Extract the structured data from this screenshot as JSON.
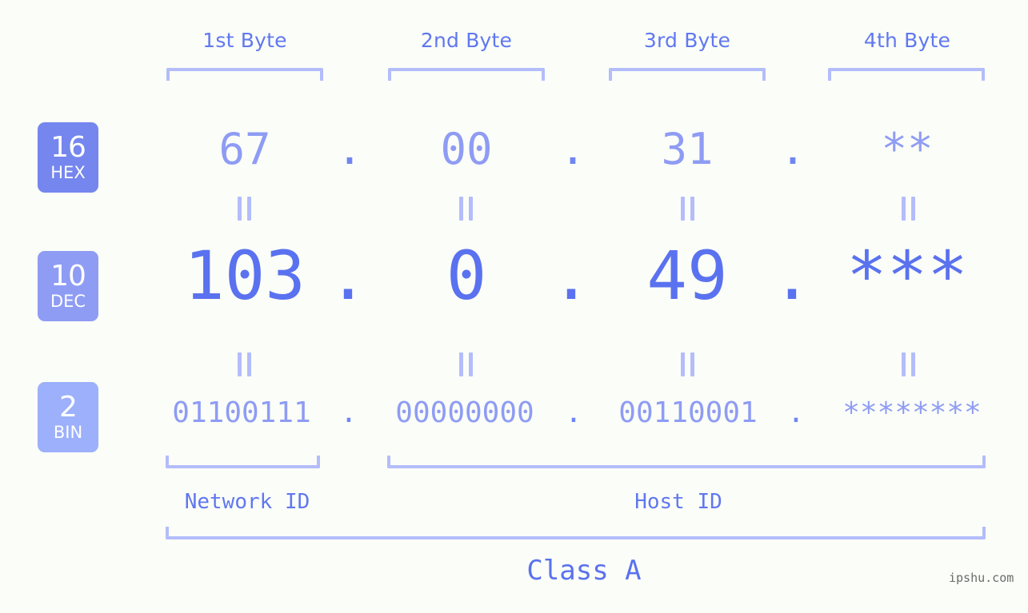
{
  "meta": {
    "watermark": "ipshu.com",
    "accent_strong": "#5a72ef",
    "accent_mid": "#8e9cf4",
    "accent_light": "#b3bdfb",
    "background": "#fbfdf8"
  },
  "byte_headers": [
    {
      "label": "1st Byte"
    },
    {
      "label": "2nd Byte"
    },
    {
      "label": "3rd Byte"
    },
    {
      "label": "4th Byte"
    }
  ],
  "rows": [
    {
      "badge": {
        "number": "16",
        "name": "HEX"
      },
      "separator": ".",
      "octets": [
        "67",
        "00",
        "31",
        "**"
      ]
    },
    {
      "badge": {
        "number": "10",
        "name": "DEC"
      },
      "separator": ".",
      "octets": [
        "103",
        "0",
        "49",
        "***"
      ]
    },
    {
      "badge": {
        "number": "2",
        "name": "BIN"
      },
      "separator": ".",
      "octets": [
        "01100111",
        "00000000",
        "00110001",
        "********"
      ]
    }
  ],
  "equality_marks": {
    "glyph": "=",
    "rows": [
      [
        "=",
        "=",
        "=",
        "="
      ],
      [
        "=",
        "=",
        "=",
        "="
      ]
    ]
  },
  "segments": {
    "network_id": "Network ID",
    "host_id": "Host ID",
    "class": "Class A"
  }
}
